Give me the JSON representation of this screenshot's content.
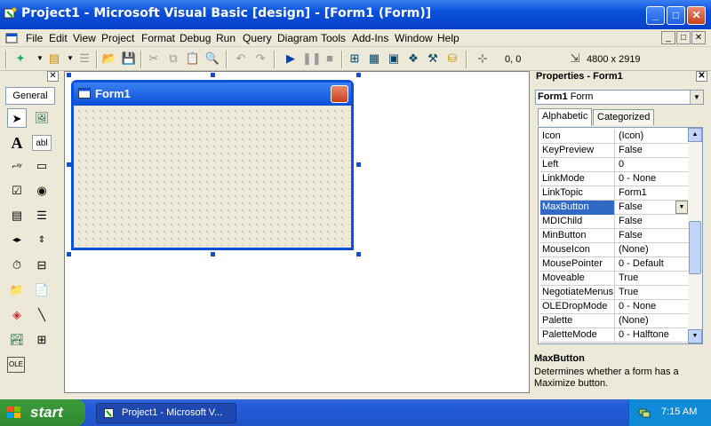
{
  "window": {
    "title": "Project1 - Microsoft Visual Basic [design] - [Form1 (Form)]"
  },
  "caption_buttons": {
    "minimize": "_",
    "maximize": "□",
    "close": "✕"
  },
  "menu": [
    "File",
    "Edit",
    "View",
    "Project",
    "Format",
    "Debug",
    "Run",
    "Query",
    "Diagram",
    "Tools",
    "Add-Ins",
    "Window",
    "Help"
  ],
  "toolbar": {
    "position": "0, 0",
    "size": "4800 x 2919"
  },
  "toolbox": {
    "tab_label": "General",
    "close": "✕"
  },
  "form": {
    "title": "Form1",
    "close": "✕"
  },
  "properties": {
    "title": "Properties - Form1",
    "close": "✕",
    "object_name": "Form1",
    "object_type": "Form",
    "tabs": [
      "Alphabetic",
      "Categorized"
    ],
    "rows": [
      {
        "name": "Icon",
        "value": "(Icon)"
      },
      {
        "name": "KeyPreview",
        "value": "False"
      },
      {
        "name": "Left",
        "value": "0"
      },
      {
        "name": "LinkMode",
        "value": "0 - None"
      },
      {
        "name": "LinkTopic",
        "value": "Form1"
      },
      {
        "name": "MaxButton",
        "value": "False"
      },
      {
        "name": "MDIChild",
        "value": "False"
      },
      {
        "name": "MinButton",
        "value": "False"
      },
      {
        "name": "MouseIcon",
        "value": "(None)"
      },
      {
        "name": "MousePointer",
        "value": "0 - Default"
      },
      {
        "name": "Moveable",
        "value": "True"
      },
      {
        "name": "NegotiateMenus",
        "value": "True"
      },
      {
        "name": "OLEDropMode",
        "value": "0 - None"
      },
      {
        "name": "Palette",
        "value": "(None)"
      },
      {
        "name": "PaletteMode",
        "value": "0 - Halftone"
      }
    ],
    "selected_row": "MaxButton",
    "description_name": "MaxButton",
    "description_text": "Determines whether a form has a Maximize button."
  },
  "taskbar": {
    "start": "start",
    "task": "Project1 - Microsoft V...",
    "clock": "7:15 AM"
  },
  "colors": {
    "title_blue": "#0a50d8",
    "selection": "#316ac5",
    "taskbar": "#245edb",
    "start_green": "#3c9a3c"
  }
}
